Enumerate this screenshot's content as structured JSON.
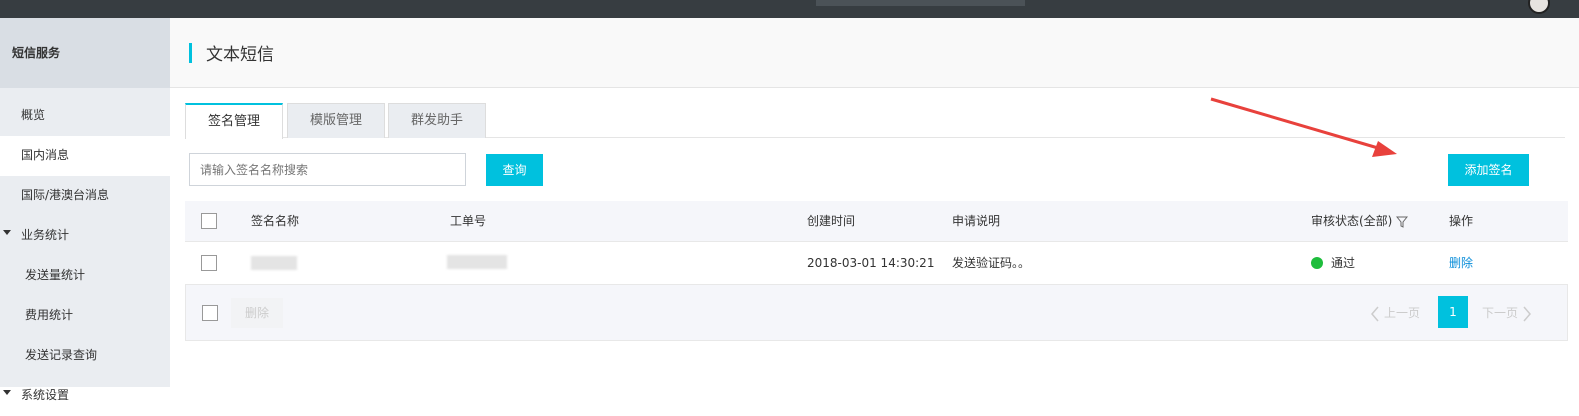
{
  "sidebar": {
    "title": "短信服务",
    "items": [
      {
        "label": "概览"
      },
      {
        "label": "国内消息"
      },
      {
        "label": "国际/港澳台消息"
      },
      {
        "label": "业务统计"
      },
      {
        "label": "发送量统计"
      },
      {
        "label": "费用统计"
      },
      {
        "label": "发送记录查询"
      },
      {
        "label": "系统设置"
      }
    ]
  },
  "header": {
    "title": "文本短信"
  },
  "tabs": [
    {
      "label": "签名管理",
      "active": true
    },
    {
      "label": "模版管理",
      "active": false
    },
    {
      "label": "群发助手",
      "active": false
    }
  ],
  "search": {
    "placeholder": "请输入签名名称搜索",
    "button_label": "查询"
  },
  "add_button_label": "添加签名",
  "table": {
    "columns": [
      "签名名称",
      "工单号",
      "创建时间",
      "申请说明",
      "审核状态(全部)",
      "操作"
    ],
    "rows": [
      {
        "created": "2018-03-01 14:30:21",
        "description": "发送验证码。。",
        "status": "通过",
        "action": "删除"
      }
    ]
  },
  "footer": {
    "delete_label": "删除",
    "prev_label": "上一页",
    "current_page": "1",
    "next_label": "下一页"
  },
  "colors": {
    "accent": "#00c1de",
    "status_ok": "#1ebd3c",
    "link": "#0b8ed9",
    "annotation_arrow": "#e8413c"
  }
}
